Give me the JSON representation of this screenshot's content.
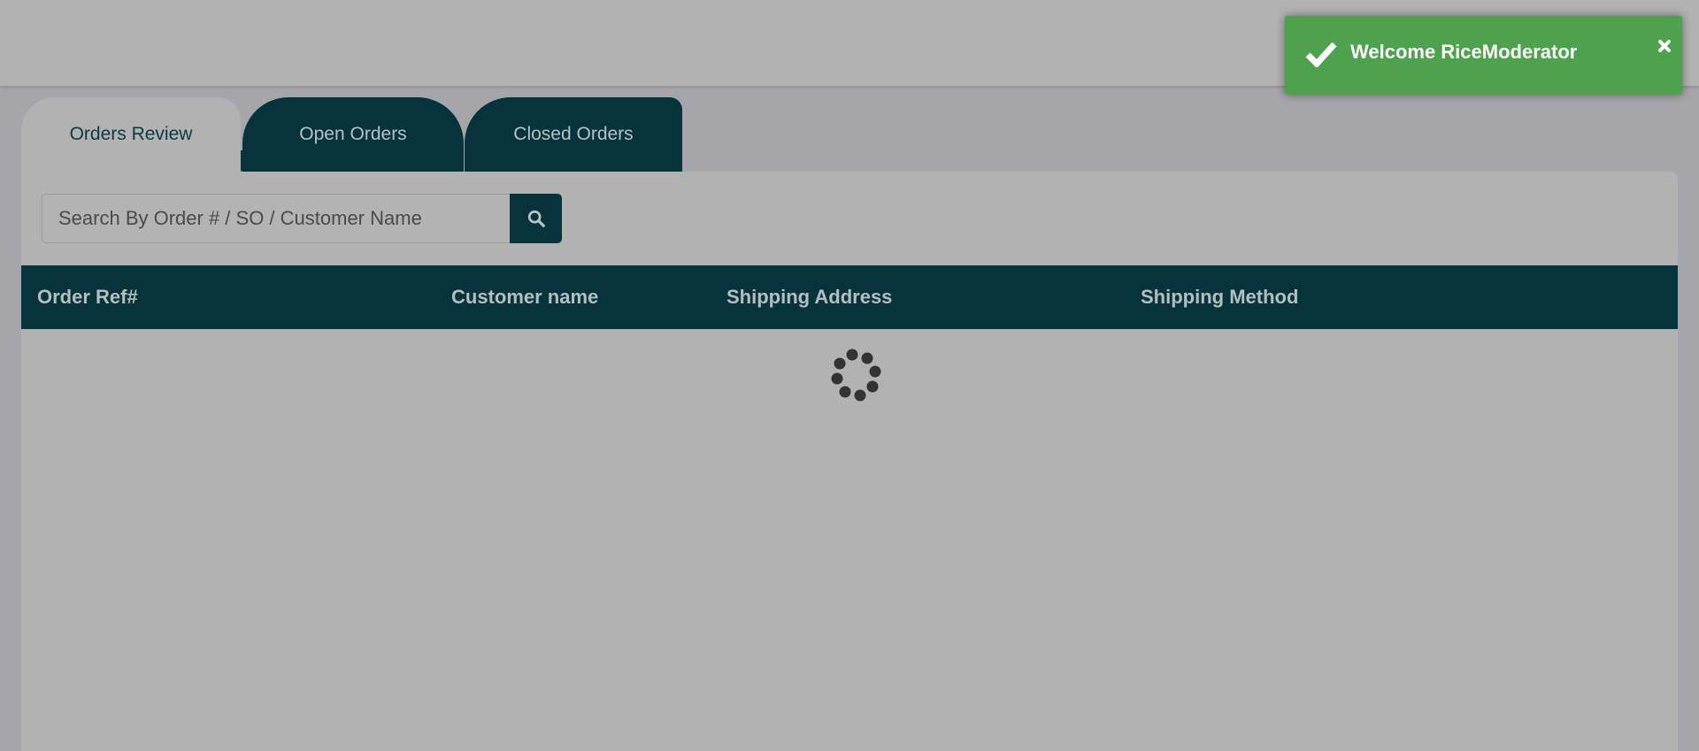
{
  "tabs": [
    {
      "label": "Orders Review",
      "active": true
    },
    {
      "label": "Open Orders",
      "active": false
    },
    {
      "label": "Closed Orders",
      "active": false
    }
  ],
  "search": {
    "placeholder": "Search By Order # / SO / Customer Name",
    "value": "",
    "button_icon": "search-icon"
  },
  "table": {
    "columns": [
      "Order Ref#",
      "Customer name",
      "Shipping Address",
      "Shipping Method"
    ],
    "rows": [],
    "loading": true
  },
  "toast": {
    "message": "Welcome RiceModerator",
    "icon": "check-icon",
    "close_icon": "close-icon",
    "color": "#4ea24e"
  },
  "colors": {
    "primary": "#07343c",
    "overlay": "#a6a6aa"
  }
}
